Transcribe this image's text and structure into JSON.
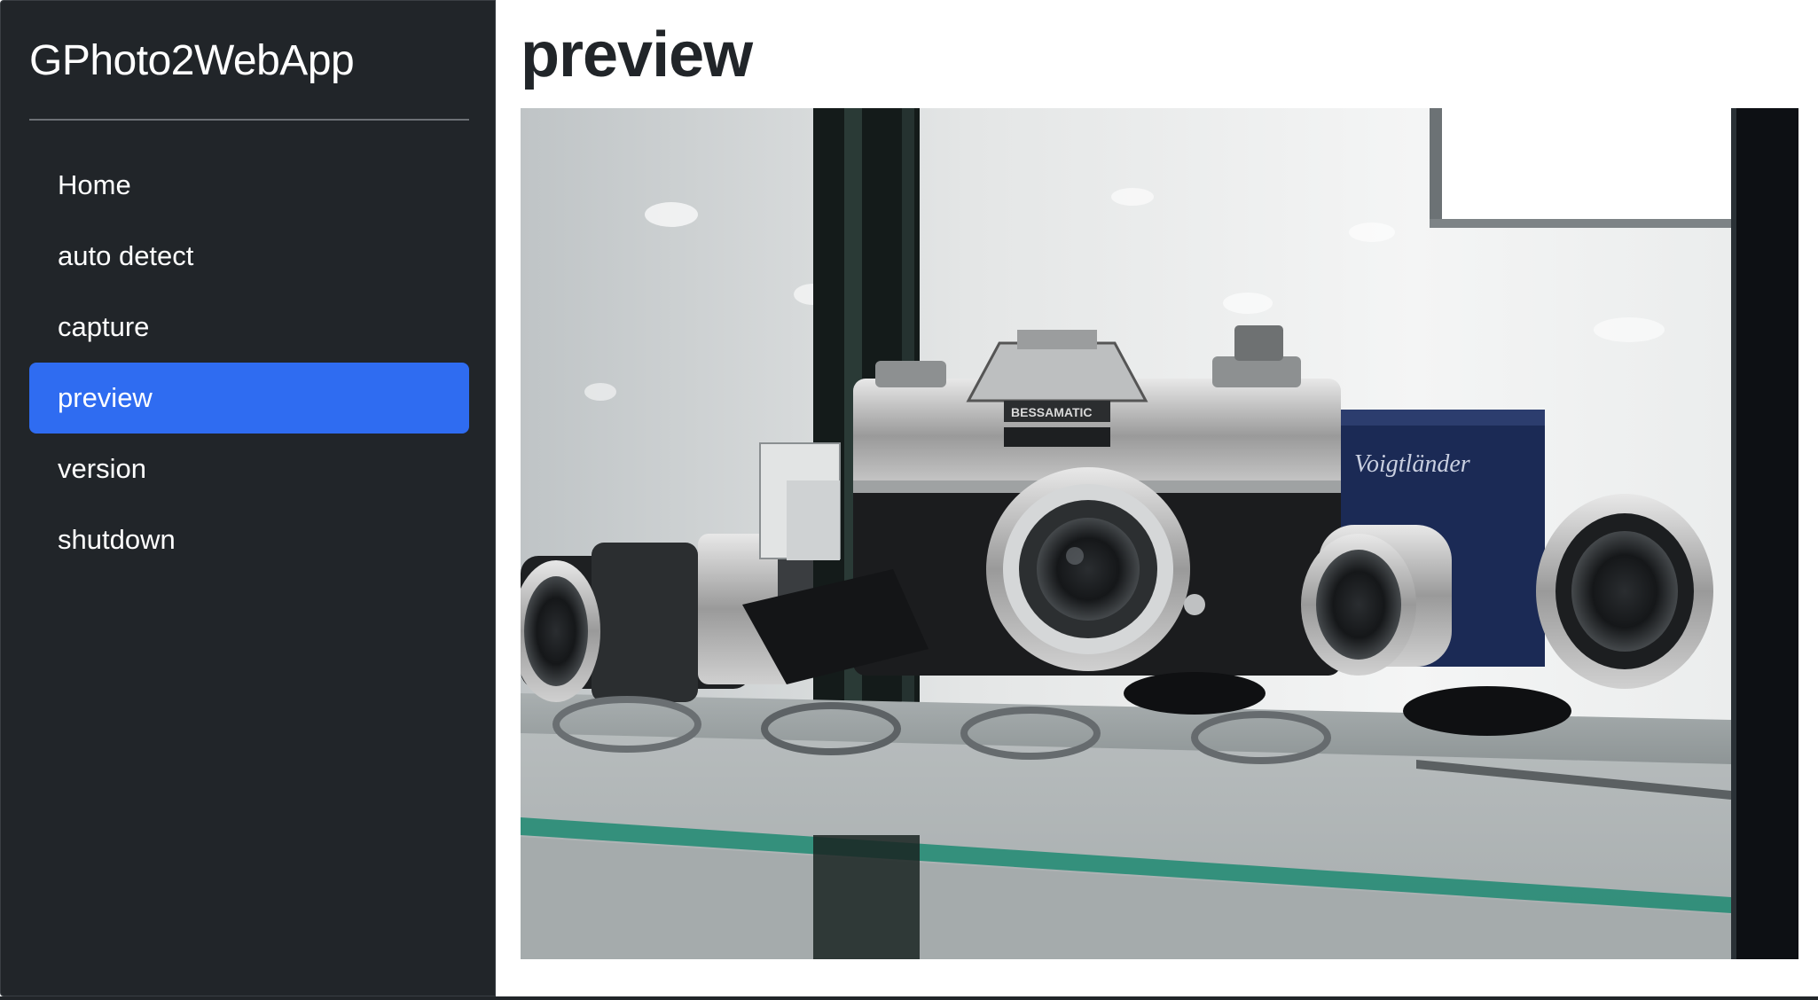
{
  "app": {
    "brand": "GPhoto2WebApp"
  },
  "sidebar": {
    "items": [
      {
        "label": "Home",
        "active": false
      },
      {
        "label": "auto detect",
        "active": false
      },
      {
        "label": "capture",
        "active": false
      },
      {
        "label": "preview",
        "active": true
      },
      {
        "label": "version",
        "active": false
      },
      {
        "label": "shutdown",
        "active": false
      }
    ]
  },
  "main": {
    "title": "preview",
    "preview_image": {
      "description_icon": "camera-preview-image",
      "camera_label": "BESSAMATIC",
      "box_label": "Voigtländer"
    }
  },
  "colors": {
    "sidebar_bg": "#212529",
    "active_item_bg": "#2f6cf1",
    "text_light": "#ffffff",
    "text_dark": "#212529"
  }
}
